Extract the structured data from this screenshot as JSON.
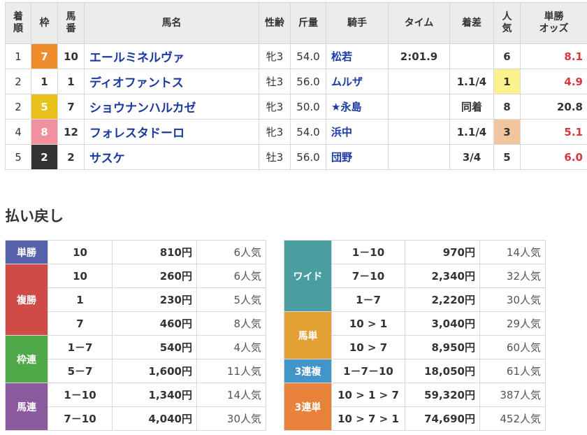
{
  "headers": {
    "rank": [
      "着",
      "順"
    ],
    "waku": "枠",
    "umaban": [
      "馬",
      "番"
    ],
    "horse": "馬名",
    "sexage": "性齢",
    "weight": "斤量",
    "jockey": "騎手",
    "time": "タイム",
    "margin": "着差",
    "pop": [
      "人",
      "気"
    ],
    "odds": [
      "単勝",
      "オッズ"
    ]
  },
  "colors": {
    "waku": {
      "1": "#ffffff",
      "2": "#333333",
      "5": "#e8c21a",
      "7": "#ef8d2c",
      "8": "#f2909f"
    },
    "pop_highlight": {
      "1": "#fdf38e",
      "3": "#f2c59e"
    },
    "label": {
      "win": "#5561aa",
      "place": "#cf4b48",
      "wakuren": "#4ea847",
      "umaren": "#8b5a9e",
      "wide": "#4b9ea0",
      "umatan": "#e3a035",
      "trio": "#4195c8",
      "trifecta": "#e8823a"
    }
  },
  "results": [
    {
      "rank": "1",
      "waku": "7",
      "umaban": "10",
      "horse": "エールミネルヴァ",
      "sexage": "牝3",
      "weight": "54.0",
      "jockey": "松若",
      "time": "2:01.9",
      "margin": "",
      "pop": "6",
      "odds": "8.1"
    },
    {
      "rank": "2",
      "waku": "1",
      "umaban": "1",
      "horse": "ディオファントス",
      "sexage": "牡3",
      "weight": "56.0",
      "jockey": "ムルザ",
      "time": "",
      "margin": "1.1/4",
      "pop": "1",
      "odds": "4.9"
    },
    {
      "rank": "2",
      "waku": "5",
      "umaban": "7",
      "horse": "ショウナンハルカゼ",
      "sexage": "牝3",
      "weight": "50.0",
      "jockey": "★永島",
      "time": "",
      "margin": "同着",
      "pop": "8",
      "odds": "20.8"
    },
    {
      "rank": "4",
      "waku": "8",
      "umaban": "12",
      "horse": "フォレスタドーロ",
      "sexage": "牝3",
      "weight": "54.0",
      "jockey": "浜中",
      "time": "",
      "margin": "1.1/4",
      "pop": "3",
      "odds": "5.1"
    },
    {
      "rank": "5",
      "waku": "2",
      "umaban": "2",
      "horse": "サスケ",
      "sexage": "牡3",
      "weight": "56.0",
      "jockey": "団野",
      "time": "",
      "margin": "3/4",
      "pop": "5",
      "odds": "6.0"
    }
  ],
  "payout_title": "払い戻し",
  "payouts_left": [
    {
      "label": "単勝",
      "rows": [
        {
          "num": "10",
          "amount": "810円",
          "pop": "6人気"
        }
      ]
    },
    {
      "label": "複勝",
      "rows": [
        {
          "num": "10",
          "amount": "260円",
          "pop": "6人気"
        },
        {
          "num": "1",
          "amount": "230円",
          "pop": "5人気"
        },
        {
          "num": "7",
          "amount": "460円",
          "pop": "8人気"
        }
      ]
    },
    {
      "label": "枠連",
      "rows": [
        {
          "num": "1－7",
          "amount": "540円",
          "pop": "4人気"
        },
        {
          "num": "5－7",
          "amount": "1,600円",
          "pop": "11人気"
        }
      ]
    },
    {
      "label": "馬連",
      "rows": [
        {
          "num": "1－10",
          "amount": "1,340円",
          "pop": "14人気"
        },
        {
          "num": "7－10",
          "amount": "4,040円",
          "pop": "30人気"
        }
      ]
    }
  ],
  "payouts_right": [
    {
      "label": "ワイド",
      "rows": [
        {
          "num": "1－10",
          "amount": "970円",
          "pop": "14人気"
        },
        {
          "num": "7－10",
          "amount": "2,340円",
          "pop": "32人気"
        },
        {
          "num": "1－7",
          "amount": "2,220円",
          "pop": "30人気"
        }
      ]
    },
    {
      "label": "馬単",
      "rows": [
        {
          "num": "10 > 1",
          "amount": "3,040円",
          "pop": "29人気"
        },
        {
          "num": "10 > 7",
          "amount": "8,950円",
          "pop": "60人気"
        }
      ]
    },
    {
      "label": "3連複",
      "rows": [
        {
          "num": "1－7－10",
          "amount": "18,050円",
          "pop": "61人気"
        }
      ]
    },
    {
      "label": "3連単",
      "rows": [
        {
          "num": "10 > 1 > 7",
          "amount": "59,320円",
          "pop": "387人気"
        },
        {
          "num": "10 > 7 > 1",
          "amount": "74,690円",
          "pop": "452人気"
        }
      ]
    }
  ]
}
